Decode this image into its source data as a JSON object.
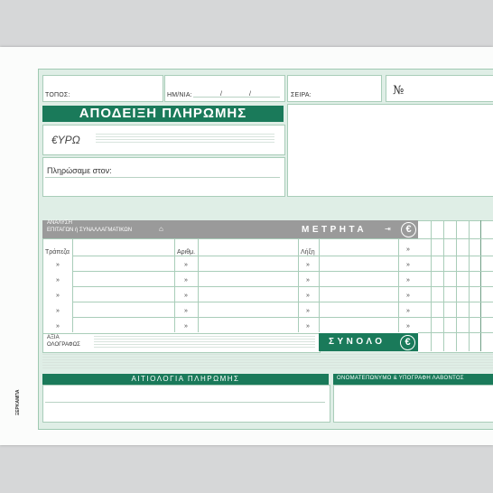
{
  "receipt": {
    "place_label": "ΤΟΠΟΣ:",
    "date_label": "ΗΜ/ΝΙΑ:",
    "date_sep1": "/",
    "date_sep2": "/",
    "series_label": "ΣΕΙΡΑ:",
    "number_label": "№",
    "title": "ΑΠΟΔΕΙΞΗ ΠΛΗΡΩΜΗΣ",
    "currency_label": "€ΥΡΩ",
    "paid_to_label": "Πληρώσαμε στον:",
    "analysis_line1": "ΑΝΑΛΥΣΗ",
    "analysis_line2": "ΕΠΙΤΑΓΩΝ ή ΣΥΝΑΛΛΑΓΜΑΤΙΚΩΝ",
    "cash_label": "ΜΕΤΡΗΤΑ",
    "euro_symbol": "€",
    "col_bank": "Τράπεζα",
    "col_number": "Αριθμ.",
    "col_expiry": "Λήξη",
    "ditto": "»",
    "value_label_1": "ΑΞΙΑ",
    "value_label_2": "ΟΛΟΓΡΑΦΩΣ",
    "total_label": "ΣΥΝΟΛΟ",
    "reason_label": "ΑΙΤΙΟΛΟΓΙΑ ΠΛΗΡΩΜΗΣ",
    "recipient_label": "ΟΝΟΜΑΤΕΠΩΝΥΜΟ & ΥΠΟΓΡΑΦΗ ΛΑΒΟΝΤΟΣ",
    "publisher_mark": "ΞΕΡΚΑΜΠΑ"
  },
  "colors": {
    "accent_green": "#1a7a5a",
    "band_grey": "#9a9a9a",
    "form_tint": "#dfeee6"
  }
}
